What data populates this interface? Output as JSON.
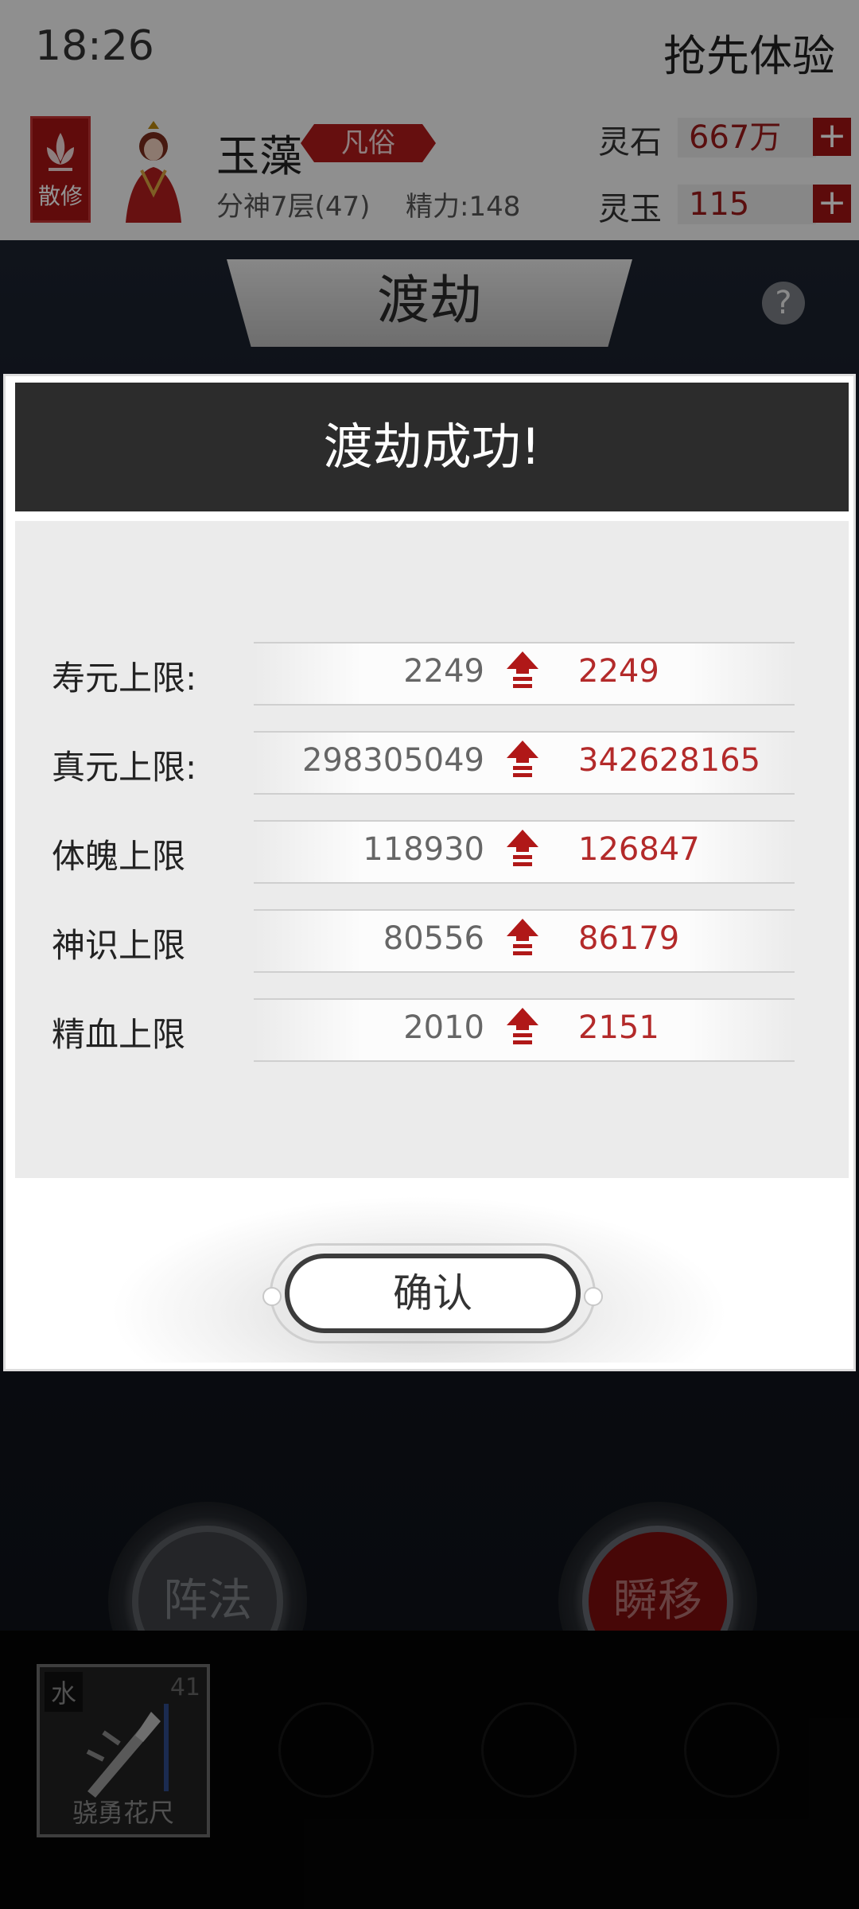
{
  "status_bar": {
    "time": "18:26",
    "right_label": "抢先体验"
  },
  "player": {
    "sect_badge": "散修",
    "name": "玉藻",
    "rank_badge": "凡俗",
    "realm": "分神7层(47)",
    "energy": "精力:148"
  },
  "resources": [
    {
      "label": "灵石",
      "value": "667万"
    },
    {
      "label": "灵玉",
      "value": "115"
    }
  ],
  "scene": {
    "tab_title": "渡劫",
    "help_symbol": "?"
  },
  "skills": [
    {
      "label": "阵法"
    },
    {
      "label": "瞬移"
    }
  ],
  "inventory": {
    "item": {
      "element": "水",
      "count": "41",
      "name": "骁勇花尺"
    }
  },
  "dialog": {
    "title": "渡劫成功!",
    "stats": [
      {
        "label": "寿元上限:",
        "old": "2249",
        "new": "2249"
      },
      {
        "label": "真元上限:",
        "old": "298305049",
        "new": "342628165"
      },
      {
        "label": "体魄上限",
        "old": "118930",
        "new": "126847"
      },
      {
        "label": "神识上限",
        "old": "80556",
        "new": "86179"
      },
      {
        "label": "精血上限",
        "old": "2010",
        "new": "2151"
      }
    ],
    "confirm_label": "确认"
  }
}
